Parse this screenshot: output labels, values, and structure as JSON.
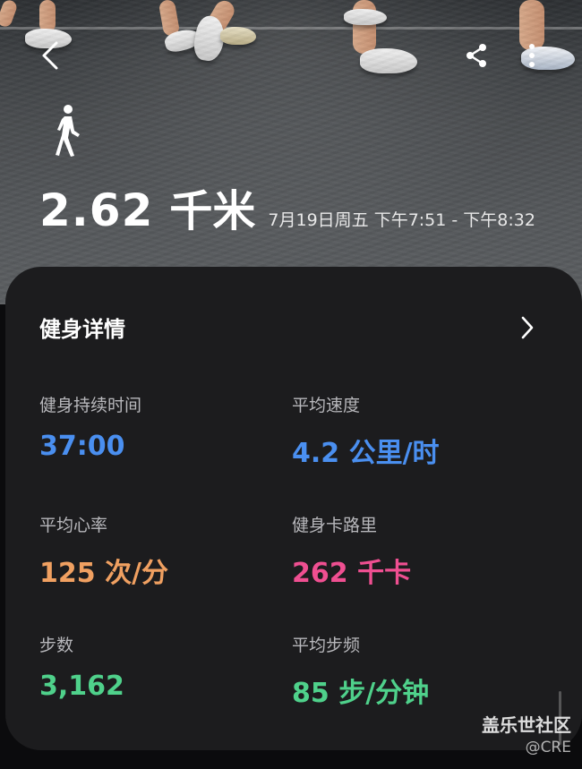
{
  "header": {
    "back_icon": "back-arrow-icon",
    "share_icon": "share-icon",
    "more_icon": "more-vertical-icon"
  },
  "activity": {
    "type_icon": "walking-icon",
    "distance_value": "2.62",
    "distance_unit": "千米",
    "time_range": "7月19日周五 下午7:51 - 下午8:32"
  },
  "details": {
    "title": "健身详情",
    "chevron_icon": "chevron-right-icon",
    "metrics": [
      {
        "label": "健身持续时间",
        "value": "37:00",
        "color": "#4a8ff0"
      },
      {
        "label": "平均速度",
        "value": "4.2 公里/时",
        "color": "#4a8ff0"
      },
      {
        "label": "平均心率",
        "value": "125 次/分",
        "color": "#f0a061"
      },
      {
        "label": "健身卡路里",
        "value": "262 千卡",
        "color": "#ef4f91"
      },
      {
        "label": "步数",
        "value": "3,162",
        "color": "#4fd18b"
      },
      {
        "label": "平均步频",
        "value": "85 步/分钟",
        "color": "#4fd18b"
      }
    ]
  },
  "watermark": {
    "title": "盖乐世社区",
    "subtitle": "@CRE"
  }
}
